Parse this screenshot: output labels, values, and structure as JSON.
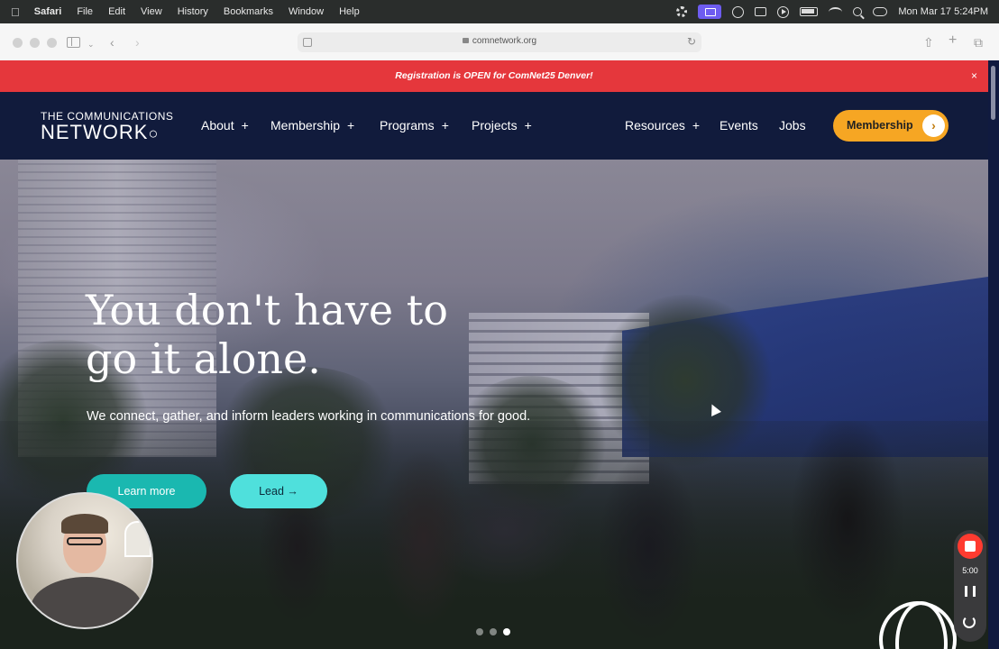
{
  "menubar": {
    "apple_icon": "apple-logo",
    "app_name": "Safari",
    "menus": [
      "File",
      "Edit",
      "View",
      "History",
      "Bookmarks",
      "Window",
      "Help"
    ],
    "clock": "Mon Mar 17  5:24PM"
  },
  "browser": {
    "url": "comnetwork.org"
  },
  "alert": {
    "text": "Registration is OPEN for ComNet25 Denver!",
    "close": "×"
  },
  "nav": {
    "logo_line1": "THE COMMUNICATIONS",
    "logo_line2": "NETWORK",
    "items": [
      {
        "label": "About",
        "plus": "+"
      },
      {
        "label": "Membership",
        "plus": "+"
      },
      {
        "label": "Programs",
        "plus": "+"
      },
      {
        "label": "Projects",
        "plus": "+"
      },
      {
        "label": "Resources",
        "plus": "+"
      },
      {
        "label": "Events"
      },
      {
        "label": "Jobs"
      }
    ],
    "cta_label": "Membership",
    "cta_arrow": "›"
  },
  "hero": {
    "title_line1": "You don't have to",
    "title_line2": "go it alone.",
    "subtitle": "We connect, gather, and inform leaders working in communications for good.",
    "learn_more": "Learn more",
    "lead": "Lead →",
    "slides": 3,
    "active_slide": 3
  },
  "recorder": {
    "time": "5:00"
  },
  "colors": {
    "alert_red": "#e5373c",
    "nav_navy": "#111b3c",
    "cta_orange": "#f6a623",
    "teal": "#1ab8b0",
    "light_teal": "#4fe0dc"
  }
}
